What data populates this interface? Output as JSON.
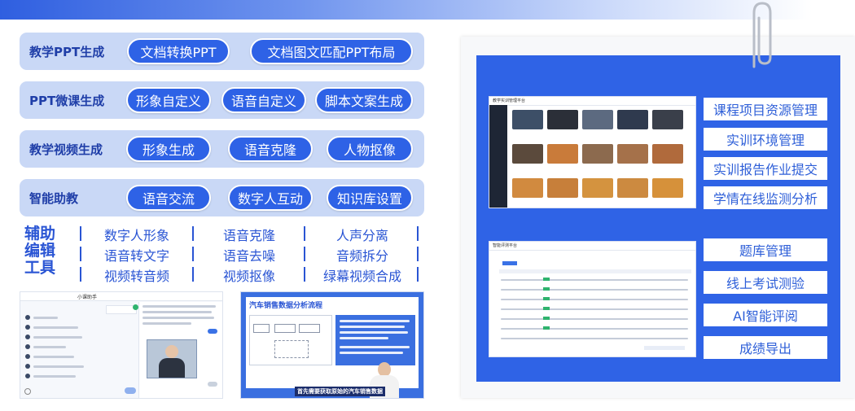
{
  "rows": [
    {
      "title": "教学PPT生成",
      "pills": [
        "文档转换PPT",
        "文档图文匹配PPT布局"
      ]
    },
    {
      "title": "PPT微课生成",
      "pills": [
        "形象自定义",
        "语音自定义",
        "脚本文案生成"
      ]
    },
    {
      "title": "教学视频生成",
      "pills": [
        "形象生成",
        "语音克隆",
        "人物抠像"
      ]
    },
    {
      "title": "智能助教",
      "pills": [
        "语音交流",
        "数字人互动",
        "知识库设置"
      ]
    }
  ],
  "tools": {
    "title": "辅助编辑工具",
    "items": [
      "数字人形象",
      "语音克隆",
      "人声分离",
      "语音转文字",
      "语音去噪",
      "音频拆分",
      "视频转音频",
      "视频抠像",
      "绿幕视频合成"
    ]
  },
  "assistant_shot": {
    "title": "小课助手"
  },
  "video_shot": {
    "title": "汽车销售数据分析流程",
    "caption": "首先需要获取原始的汽车销售数据"
  },
  "platform_shot": {
    "title": "教学实训管理平台"
  },
  "exam_shot": {
    "title": "智能评测平台"
  },
  "right_buttons": [
    "课程项目资源管理",
    "实训环境管理",
    "实训报告作业提交",
    "学情在线监测分析",
    "题库管理",
    "线上考试测验",
    "AI智能评阅",
    "成绩导出"
  ],
  "colors": {
    "accent": "#2e62e6",
    "row_bg": "#c9d8f6",
    "board": "#2f63e6"
  }
}
